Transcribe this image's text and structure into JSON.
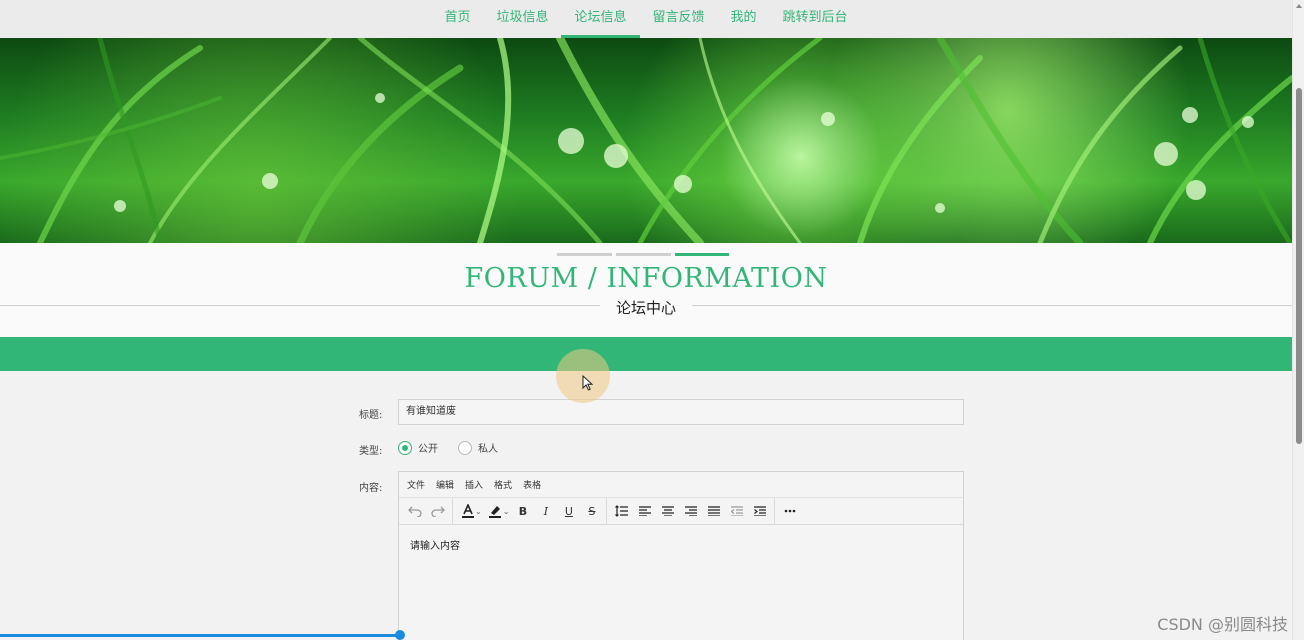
{
  "nav": {
    "items": [
      {
        "label": "首页",
        "active": false
      },
      {
        "label": "垃圾信息",
        "active": false
      },
      {
        "label": "论坛信息",
        "active": true
      },
      {
        "label": "留言反馈",
        "active": false
      },
      {
        "label": "我的",
        "active": false
      },
      {
        "label": "跳转到后台",
        "active": false
      }
    ]
  },
  "section": {
    "title_en": "FORUM / INFORMATION",
    "title_cn": "论坛中心"
  },
  "form": {
    "title_label": "标题:",
    "title_value": "有谁知道废",
    "type_label": "类型:",
    "type_options": [
      {
        "label": "公开",
        "checked": true
      },
      {
        "label": "私人",
        "checked": false
      }
    ],
    "content_label": "内容:",
    "editor": {
      "menus": [
        "文件",
        "编辑",
        "插入",
        "格式",
        "表格"
      ],
      "placeholder": "请输入内容"
    }
  },
  "colors": {
    "accent": "#32b678",
    "progress": "#1a8cdf"
  },
  "watermark": "CSDN @别圆科技"
}
